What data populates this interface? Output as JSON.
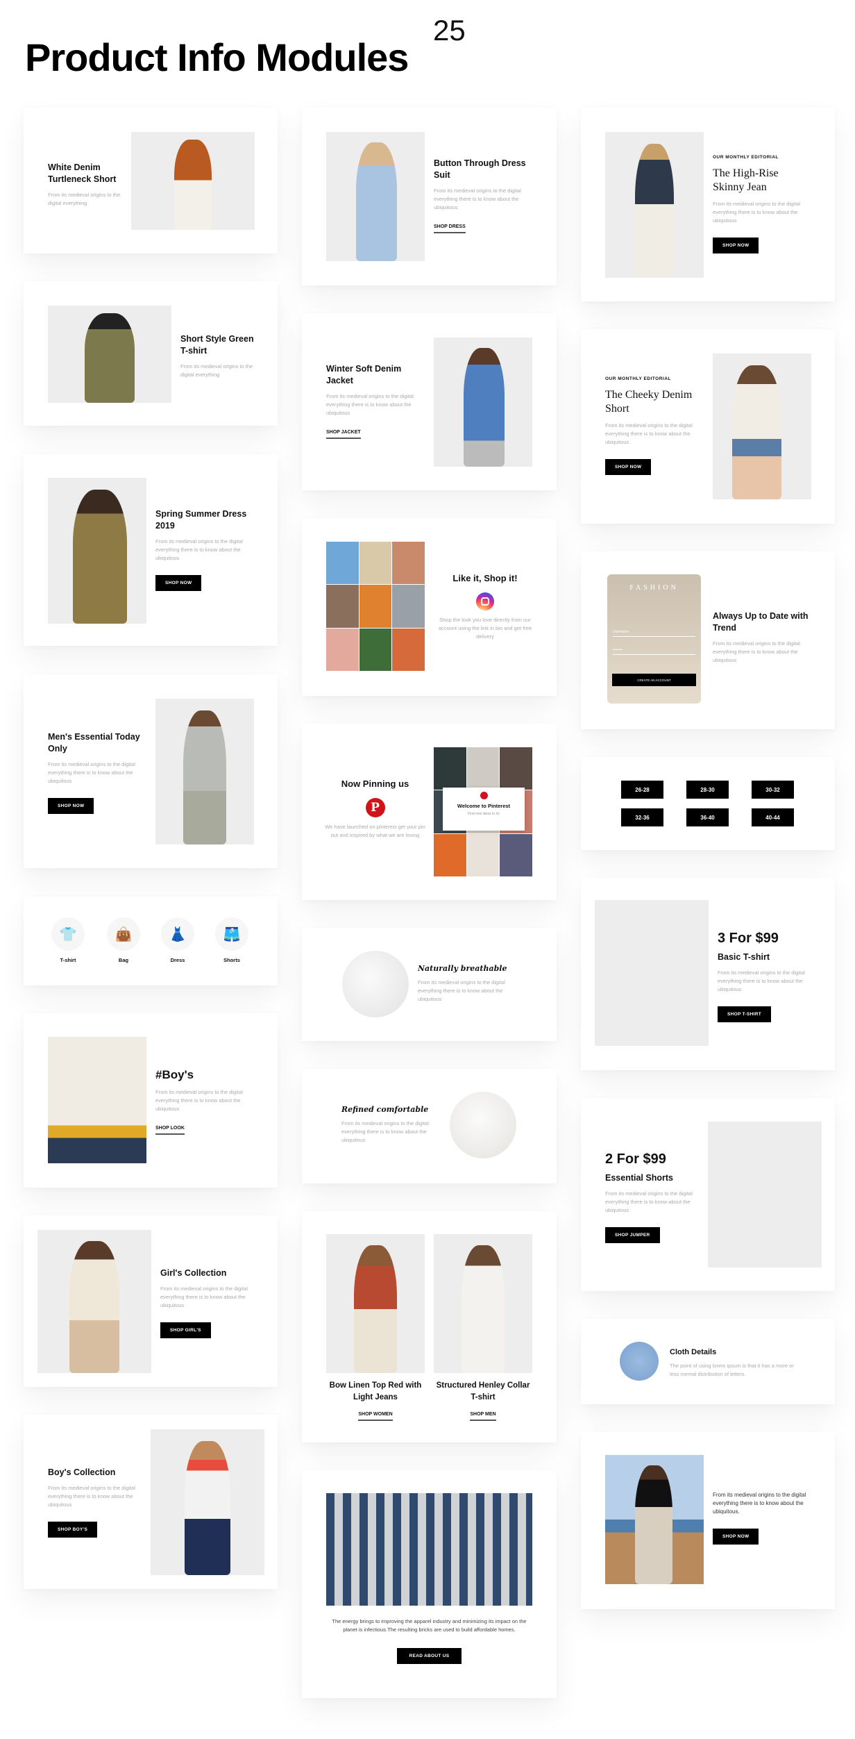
{
  "header": {
    "title": "Product Info Modules",
    "count": "25"
  },
  "col1": [
    {
      "title": "White Denim Turtleneck Short",
      "desc": "From its medieval origins to the digital everything"
    },
    {
      "title": "Short Style Green T-shirt",
      "desc": "From its medieval origins to the digital everything"
    },
    {
      "title": "Spring Summer Dress 2019",
      "desc": "From its medieval origins to the digital everything there is to know about the ubiquitous",
      "cta": "SHOP NOW"
    },
    {
      "title": "Men's Essential Today Only",
      "desc": "From its medieval origins to the digital everything there is to know about the ubiquitous",
      "cta": "SHOP NOW"
    },
    {
      "icons": [
        {
          "icon": "t-shirt-icon",
          "label": "T-shirt"
        },
        {
          "icon": "bag-icon",
          "label": "Bag"
        },
        {
          "icon": "dress-icon",
          "label": "Dress"
        },
        {
          "icon": "shorts-icon",
          "label": "Shorts"
        }
      ]
    },
    {
      "title": "#Boy's",
      "desc": "From its medieval origins to the digital everything there is to know about the ubiquitous",
      "cta": "SHOP LOOK"
    },
    {
      "title": "Girl's Collection",
      "desc": "From its medieval origins to the digital everything there is to know about the ubiquitous",
      "cta": "SHOP GIRL'S"
    },
    {
      "title": "Boy's Collection",
      "desc": "From its medieval origins to the digital everything there is to know about the ubiquitous",
      "cta": "SHOP BOY'S"
    }
  ],
  "col2": [
    {
      "title": "Button Through Dress Suit",
      "desc": "From its medieval origins to the digital everything there is to know about the ubiquitous",
      "cta": "SHOP DRESS"
    },
    {
      "title": "Winter Soft Denim Jacket",
      "desc": "From its medieval origins to the digital everything there is to know about the ubiquitous",
      "cta": "SHOP JACKET"
    },
    {
      "title": "Like it, Shop it!",
      "desc": "Shop the look you love directly from our account using the link in bio and get free delivery"
    },
    {
      "title": "Now Pinning us",
      "desc": "We have launched on pinterest get your pin out and inspired by what we are loving",
      "popup_title": "Welcome to Pinterest",
      "popup_sub": "Find new ideas to try"
    },
    {
      "title": "Naturally breathable",
      "desc": "From its medieval origins to the digital everything there is to know about the ubiquitous"
    },
    {
      "title": "Refined comfortable",
      "desc": "From its medieval origins to the digital everything there is to know about the ubiquitous"
    },
    {
      "items": [
        {
          "title": "Bow Linen Top Red with Light Jeans",
          "cta": "SHOP WOMEN"
        },
        {
          "title": "Structured Henley Collar T-shirt",
          "cta": "SHOP MEN"
        }
      ]
    },
    {
      "desc": "The energy brings to improving the apparel industry and minimizing its impact on the planet is infectious.The resulting bricks are used to build affordable homes.",
      "cta": "READ ABOUT US"
    }
  ],
  "col3": [
    {
      "eyebrow": "OUR MONTHLY EDITORIAL",
      "title": "The High-Rise Skinny Jean",
      "desc": "From its medieval origins to the digital everything there is to know about the ubiquitous",
      "cta": "SHOP NOW"
    },
    {
      "eyebrow": "OUR MONTHLY EDITORIAL",
      "title": "The Cheeky Denim Short",
      "desc": "From its medieval origins to the digital everything there is to know about the ubiquitous",
      "cta": "SHOP NOW"
    },
    {
      "title": "Always Up to Date with Trend",
      "desc": "From its medieval origins to the digital everything there is to know about the ubiquitous",
      "mock_brand": "FASHION",
      "mock_user": "Username",
      "mock_pass": "••••••••",
      "mock_cta": "CREATE AN ACCOUNT"
    },
    {
      "sizes": [
        "26-28",
        "28-30",
        "30-32",
        "32-36",
        "36-40",
        "40-44"
      ]
    },
    {
      "price": "3 For $99",
      "title": "Basic T-shirt",
      "desc": "From its medieval origins to the digital everything there is to know about the ubiquitous",
      "cta": "SHOP T-SHIRT"
    },
    {
      "price": "2 For $99",
      "title": "Essential Shorts",
      "desc": "From its medieval origins to the digital everything there is to know about the ubiquitous",
      "cta": "SHOP JUMPER"
    },
    {
      "title": "Cloth Details",
      "desc": "The point of using lorem ipsum is that it has a more or less normal distribution of letters."
    },
    {
      "desc": "From its medieval origins to the digital everything there is to know about the ubiquitous.",
      "cta": "SHOP NOW"
    }
  ],
  "colors": {
    "accent": "#000000",
    "instagram": "#d6249f",
    "pinterest": "#e60023",
    "muted_text": "#aaaaaa"
  }
}
